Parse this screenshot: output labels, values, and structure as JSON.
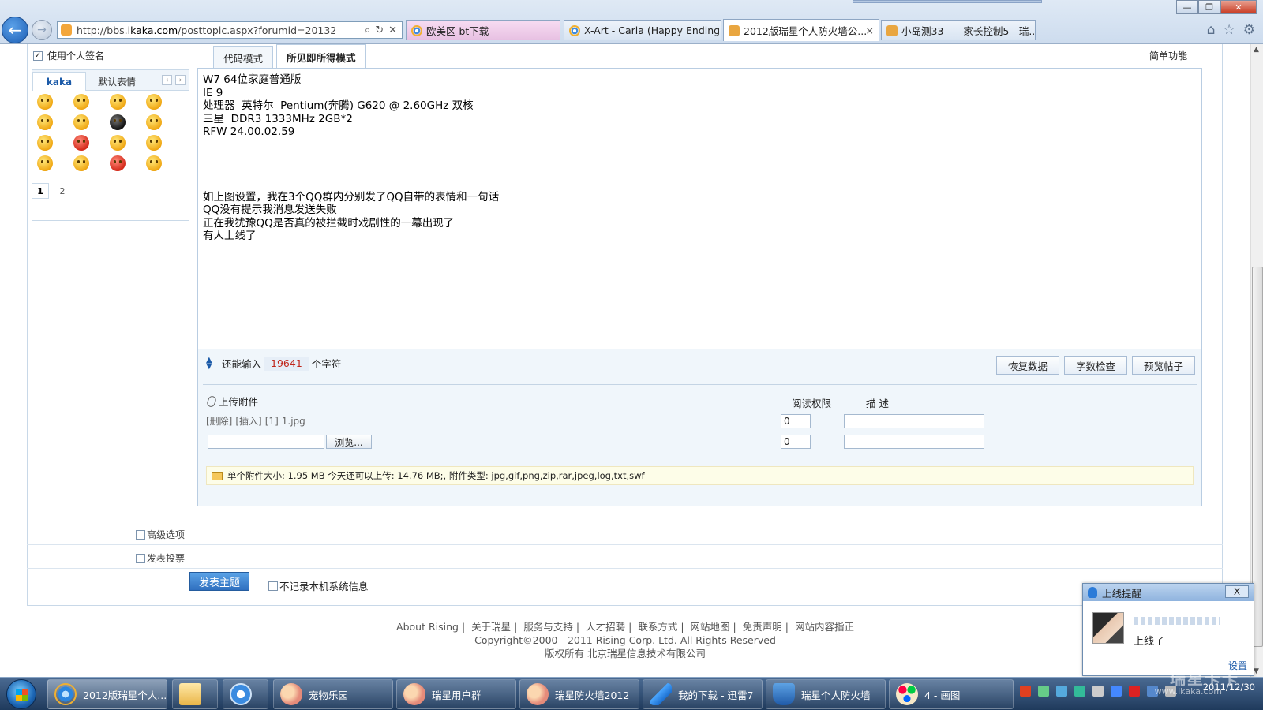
{
  "browser": {
    "address": {
      "url_prefix": "http://bbs.",
      "url_domain": "ikaka.com",
      "url_suffix": "/posttopic.aspx?forumid=20132"
    },
    "tabs": [
      {
        "label": "欧美区 bt下载"
      },
      {
        "label": "X-Art - Carla (Happy Ending..."
      },
      {
        "label": "2012版瑞星个人防火墙公...",
        "close": "×"
      },
      {
        "label": "小岛测33——家长控制5 - 瑞..."
      }
    ]
  },
  "sidebar": {
    "signature_label": "使用个人签名",
    "smiley_tabs": [
      "kaka",
      "默认表情"
    ],
    "pager": [
      "1",
      "2"
    ]
  },
  "editor": {
    "mode_tabs": [
      "代码模式",
      "所见即所得模式"
    ],
    "simple_label": "简单功能",
    "lines": [
      "W7 64位家庭普通版",
      "IE 9",
      "处理器  英特尔  Pentium(奔腾) G620 @ 2.60GHz 双核",
      "三星  DDR3 1333MHz 2GB*2",
      "RFW 24.00.02.59",
      "",
      "",
      "",
      "",
      "如上图设置，我在3个QQ群内分别发了QQ自带的表情和一句话",
      "QQ没有提示我消息发送失败",
      "正在我犹豫QQ是否真的被拦截时戏剧性的一幕出现了",
      "有人上线了"
    ],
    "counter_prefix": "还能输入",
    "counter_value": "19641",
    "counter_suffix": "个字符",
    "buttons": [
      "恢复数据",
      "字数检查",
      "预览帖子"
    ]
  },
  "attachments": {
    "header": "上传附件",
    "col_permission": "阅读权限",
    "col_description": "描  述",
    "existing": {
      "delete": "[删除]",
      "insert": "[插入]",
      "index": "[1]",
      "filename": "1.jpg",
      "permission": "0",
      "description": ""
    },
    "new_row": {
      "file": "",
      "browse": "浏览...",
      "permission": "0",
      "description": ""
    },
    "info": "单个附件大小: 1.95 MB  今天还可以上传: 14.76 MB;,  附件类型: jpg,gif,png,zip,rar,jpeg,log,txt,swf"
  },
  "options": {
    "advanced": "高级选项",
    "poll": "发表投票",
    "submit": "发表主题",
    "no_record": "不记录本机系统信息"
  },
  "footer": {
    "links": [
      "About Rising",
      "关于瑞星",
      "服务与支持",
      "人才招聘",
      "联系方式",
      "网站地图",
      "免责声明",
      "网站内容指正"
    ],
    "copyright": "Copyright©2000 - 2011 Rising Corp. Ltd.  All Rights Reserved",
    "owner": "版权所有 北京瑞星信息技术有限公司"
  },
  "popup": {
    "title": "上线提醒",
    "close": "X",
    "message": "上线了",
    "settings": "设置"
  },
  "taskbar": {
    "items": [
      {
        "label": "2012版瑞星个人...",
        "icon": "ie-icon"
      },
      {
        "label": "",
        "icon": "folder-icon"
      },
      {
        "label": "",
        "icon": "media-player-icon"
      },
      {
        "label": "宠物乐园",
        "icon": "qq-icon"
      },
      {
        "label": "瑞星用户群",
        "icon": "qq-icon"
      },
      {
        "label": "瑞星防火墙2012",
        "icon": "qq-icon"
      },
      {
        "label": "我的下载 - 迅雷7",
        "icon": "thunder-icon"
      },
      {
        "label": "瑞星个人防火墙",
        "icon": "shield-icon"
      },
      {
        "label": "4 - 画图",
        "icon": "paint-icon"
      }
    ],
    "date": "2011/12/30",
    "watermark": "瑞星卡卡",
    "watermark_sub": "www.ikaka.com"
  }
}
